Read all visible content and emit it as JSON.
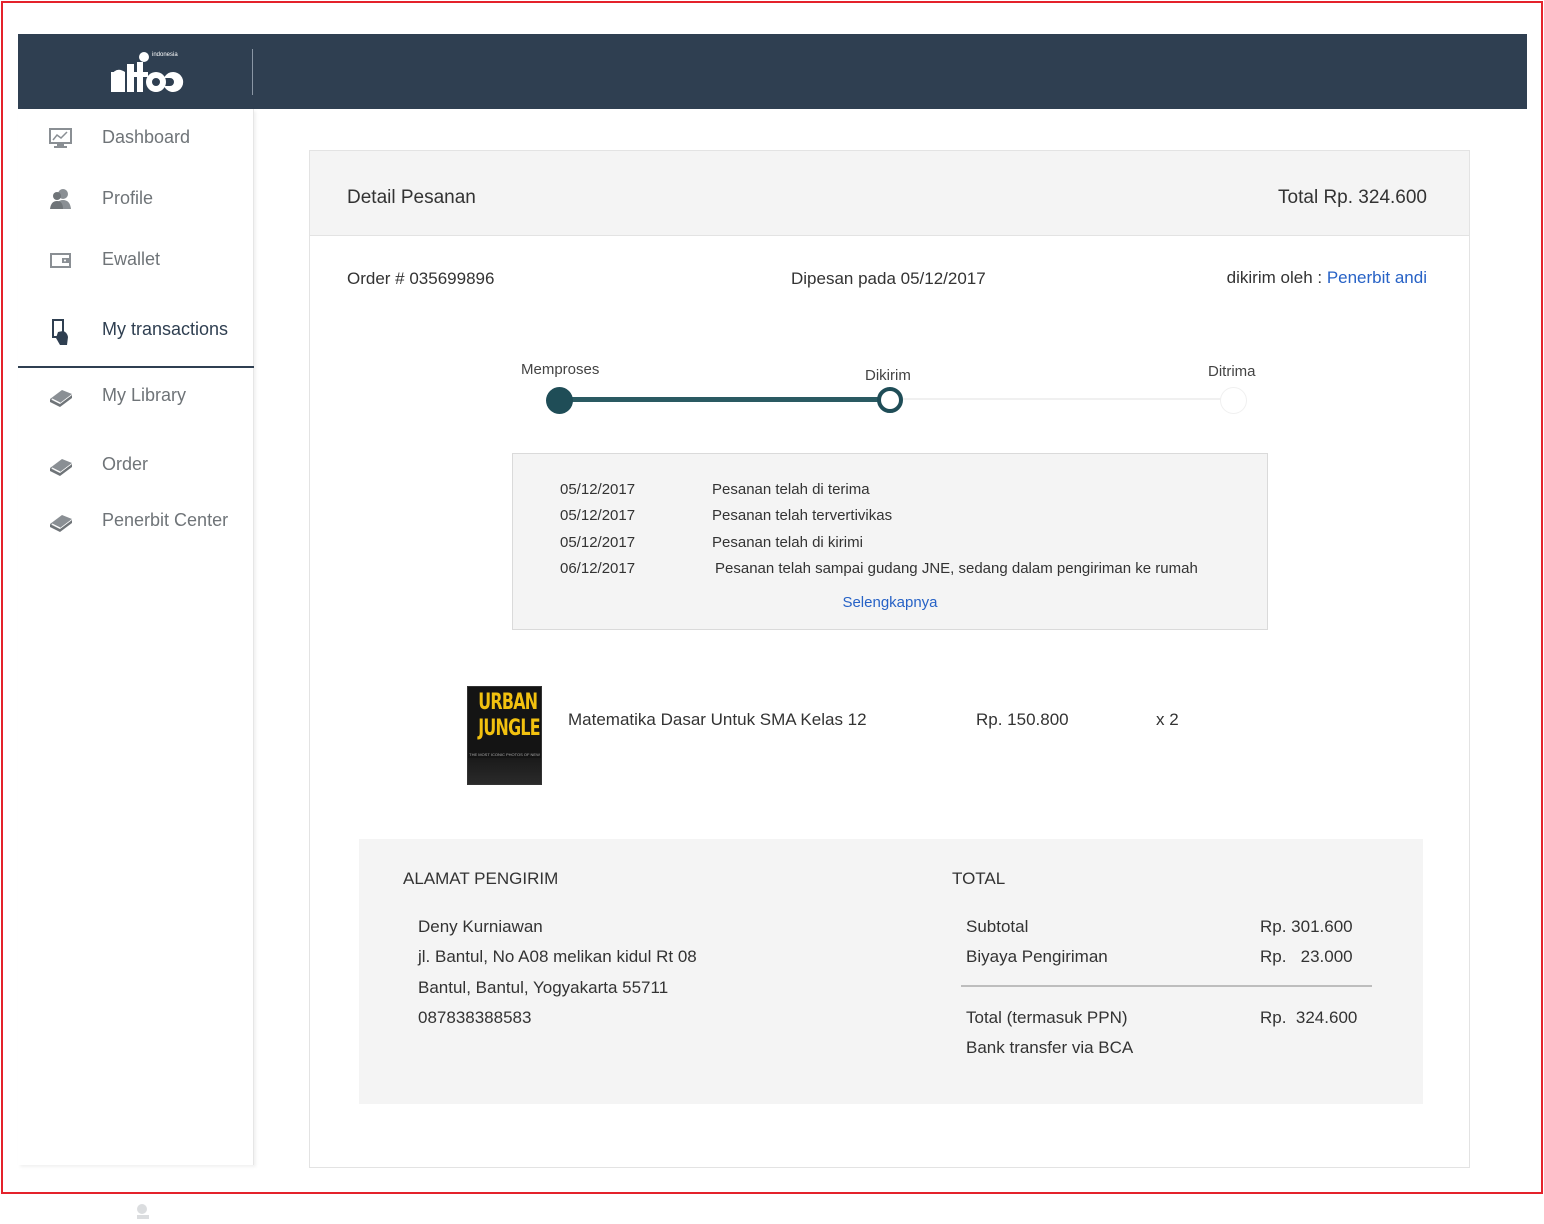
{
  "app": {
    "logo_text": "nitc",
    "logo_subtext": "indonesia"
  },
  "sidebar": {
    "items": [
      {
        "label": "Dashboard",
        "icon": "monitor-chart-icon"
      },
      {
        "label": "Profile",
        "icon": "users-icon"
      },
      {
        "label": "Ewallet",
        "icon": "wallet-icon"
      },
      {
        "label": "My transactions",
        "icon": "hand-phone-icon",
        "active": true
      },
      {
        "label": "My Library",
        "icon": "book-icon"
      },
      {
        "label": "Order",
        "icon": "book-icon"
      },
      {
        "label": "Penerbit Center",
        "icon": "book-icon"
      }
    ]
  },
  "order": {
    "header_title": "Detail Pesanan",
    "header_total": "Total Rp. 324.600",
    "order_number": "Order # 035699896",
    "order_date": "Dipesan pada 05/12/2017",
    "shipped_by_label": "dikirim oleh : ",
    "shipped_by_value": "Penerbit andi",
    "progress": {
      "steps": [
        "Memproses",
        "Dikirim",
        "Ditrima"
      ],
      "current_step": 1
    },
    "history": [
      {
        "date": "05/12/2017",
        "text": "Pesanan telah di terima"
      },
      {
        "date": "05/12/2017",
        "text": "Pesanan telah tervertivikas"
      },
      {
        "date": "05/12/2017",
        "text": "Pesanan telah di kirimi"
      },
      {
        "date": "06/12/2017",
        "text": "Pesanan telah sampai gudang JNE, sedang dalam pengiriman ke rumah"
      }
    ],
    "history_more": "Selengkapnya",
    "item": {
      "cover_title_line1": "URBAN",
      "cover_title_line2": "JUNGLE",
      "cover_subtitle": "THE MOST ICONIC PHOTOS OF NEW YORK CITY",
      "title": "Matematika Dasar Untuk SMA Kelas 12",
      "price": "Rp. 150.800",
      "qty": "x 2"
    },
    "address": {
      "heading": "ALAMAT PENGIRIM",
      "name": "Deny Kurniawan",
      "line1": "jl. Bantul, No A08 melikan kidul Rt 08",
      "line2": "Bantul, Bantul, Yogyakarta 55711",
      "phone": "087838388583"
    },
    "totals": {
      "heading": "TOTAL",
      "subtotal_label": "Subtotal",
      "subtotal_value": "Rp. 301.600",
      "shipping_label": "Biyaya Pengiriman",
      "shipping_value": "Rp.   23.000",
      "grand_label": "Total (termasuk PPN)",
      "grand_value": "Rp.  324.600",
      "payment_method": "Bank transfer via BCA"
    }
  },
  "colors": {
    "topbar": "#2f3f51",
    "accent": "#2a5a62",
    "link": "#2762c6",
    "frame_border": "#e4222b"
  }
}
